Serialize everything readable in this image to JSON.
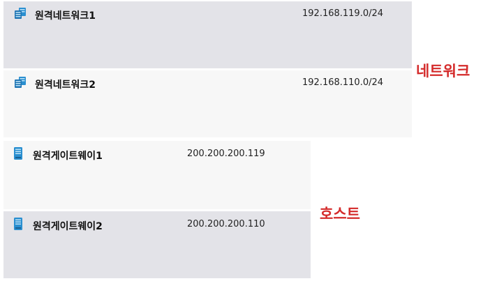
{
  "networks": [
    {
      "name": "원격네트워크1",
      "address": "192.168.119.0/24",
      "icon": "network-icon"
    },
    {
      "name": "원격네트워크2",
      "address": "192.168.110.0/24",
      "icon": "network-icon"
    }
  ],
  "hosts": [
    {
      "name": "원격게이트웨이1",
      "address": "200.200.200.119",
      "icon": "server-icon"
    },
    {
      "name": "원격게이트웨이2",
      "address": "200.200.200.110",
      "icon": "server-icon"
    }
  ],
  "annotations": {
    "network_label": "네트워크",
    "host_label": "호스트"
  },
  "colors": {
    "annotation": "#d42a2a",
    "row_dark": "#e3e3e8",
    "row_light": "#f7f7f7",
    "icon_blue": "#2a8fd0"
  }
}
